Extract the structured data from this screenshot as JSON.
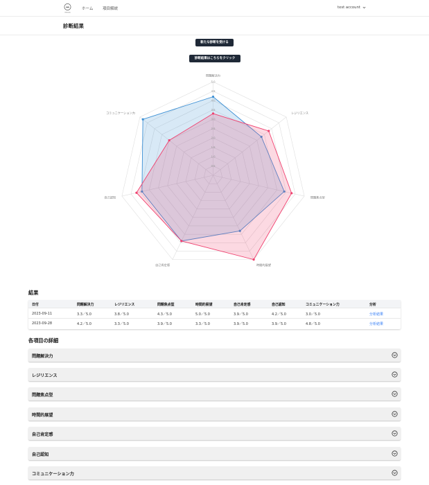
{
  "nav": {
    "logo_text": "RESILIA",
    "links": [
      "ホーム",
      "項目解説"
    ],
    "account": "test account"
  },
  "page": {
    "title": "診断結果"
  },
  "buttons": {
    "new_diagnosis": "新たな診断を受ける",
    "click_result": "診断結果はこちらをクリック"
  },
  "radar": {
    "axes": [
      "問題解決力",
      "レジリエンス",
      "問題焦点型",
      "時間的展望",
      "自己肯定感",
      "自己認知",
      "コミュニケーション力"
    ],
    "ticks": [
      "0.5",
      "1.0",
      "1.5",
      "2.0",
      "2.5",
      "3.0",
      "3.5",
      "4.0",
      "4.5",
      "5.0"
    ],
    "colors": {
      "blue": "#3b8fd4",
      "red": "#f0416f"
    }
  },
  "chart_data": {
    "type": "radar",
    "categories": [
      "問題解決力",
      "レジリエンス",
      "問題焦点型",
      "時間的展望",
      "自己肯定感",
      "自己認知",
      "コミュニケーション力"
    ],
    "rmax": 5.0,
    "series": [
      {
        "values": [
          4.2,
          3.3,
          3.9,
          3.3,
          3.9,
          3.9,
          4.8
        ],
        "color": "#3b8fd4"
      },
      {
        "values": [
          3.3,
          3.8,
          4.3,
          5.0,
          3.9,
          4.2,
          3.0
        ],
        "color": "#f0416f"
      }
    ]
  },
  "results": {
    "heading": "結果",
    "headers": [
      "日付",
      "問題解決力",
      "レジリエンス",
      "問題焦点型",
      "時間的展望",
      "自己肯定感",
      "自己認知",
      "コミュニケーション力",
      "分析"
    ],
    "rows": [
      [
        "2023-09-11",
        "3.3／5.0",
        "3.8／5.0",
        "4.3／5.0",
        "5.0／5.0",
        "3.9／5.0",
        "4.2／5.0",
        "3.0／5.0",
        "分析結果"
      ],
      [
        "2023-09-28",
        "4.2／5.0",
        "3.3／5.0",
        "3.9／5.0",
        "3.3／5.0",
        "3.9／5.0",
        "3.9／5.0",
        "4.8／5.0",
        "分析結果"
      ]
    ]
  },
  "details": {
    "heading": "各項目の詳細",
    "items": [
      "問題解決力",
      "レジリエンス",
      "問題焦点型",
      "時間的展望",
      "自己肯定感",
      "自己認知",
      "コミュニケーション力"
    ]
  }
}
